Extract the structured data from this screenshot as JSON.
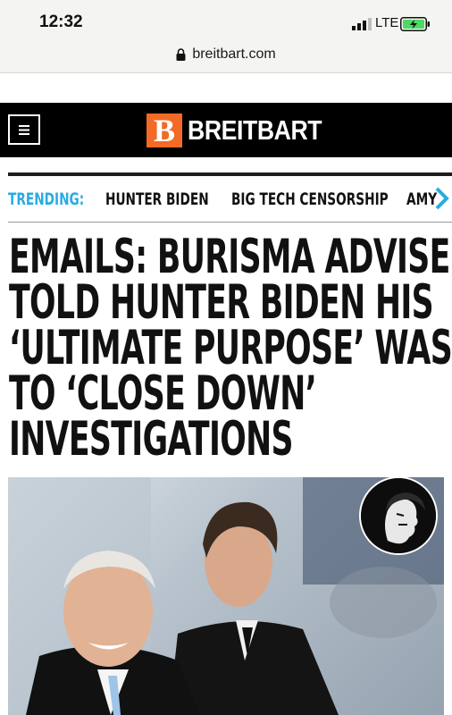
{
  "status_bar": {
    "time": "12:32",
    "network": "LTE",
    "battery_charging": true
  },
  "url_bar": {
    "domain": "breitbart.com",
    "icon": "lock-icon"
  },
  "header": {
    "menu_icon": "hamburger-menu-icon",
    "logo_mark": "B",
    "logo_text": "BREITBART",
    "brand_color": "#f26a25"
  },
  "trending": {
    "label": "TRENDING:",
    "label_color": "#29abe2",
    "items": [
      "HUNTER BIDEN",
      "BIG TECH CENSORSHIP",
      "AMY"
    ],
    "next_icon": "chevron-right-icon"
  },
  "article": {
    "headline_lines": [
      "EMAILS: BURISMA ADVISER",
      "TOLD HUNTER BIDEN HIS",
      "‘ULTIMATE PURPOSE’ WAS",
      "TO ‘CLOSE DOWN’",
      "INVESTIGATIONS"
    ],
    "photo": "article-hero-photo",
    "overlay_badge": "profile-engraving-badge"
  }
}
